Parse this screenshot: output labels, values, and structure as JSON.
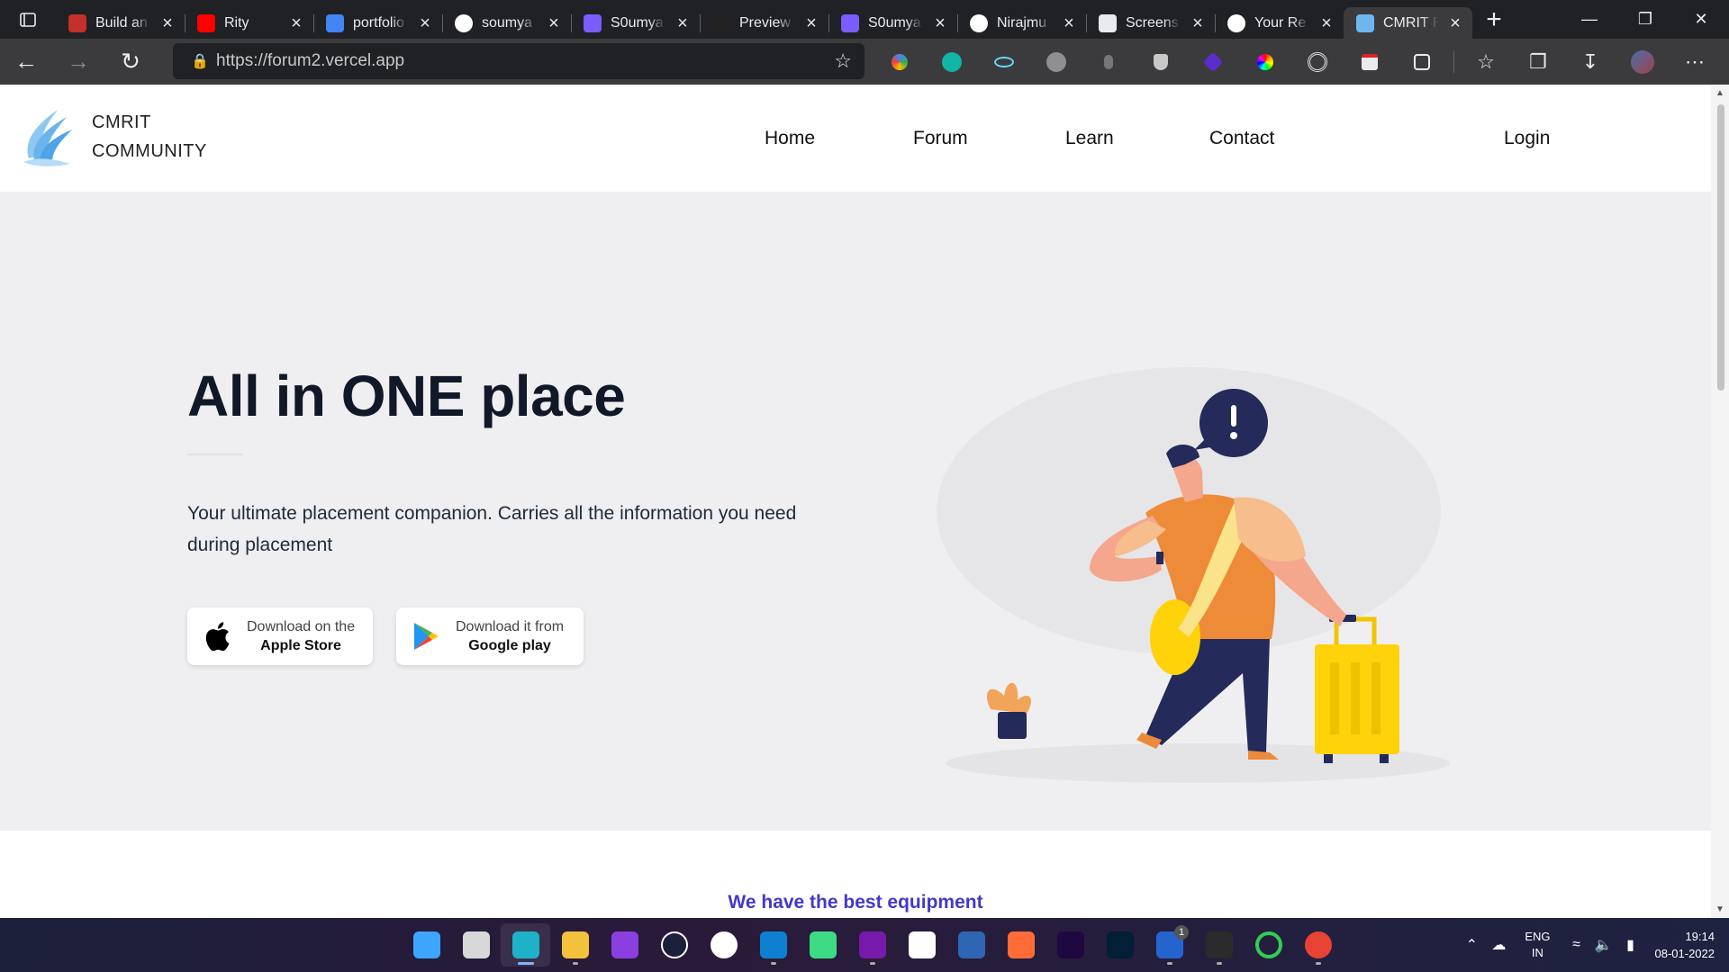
{
  "browser": {
    "tabs": [
      {
        "title": "Build an",
        "icon": "youtube-icon",
        "color": "#c4302b"
      },
      {
        "title": "Rity",
        "icon": "youtube-audio-icon",
        "color": "#ff0000"
      },
      {
        "title": "portfolio",
        "icon": "google-icon",
        "color": "#4285f4"
      },
      {
        "title": "soumya",
        "icon": "github-icon",
        "color": "#ffffff"
      },
      {
        "title": "S0umya",
        "icon": "app-icon",
        "color": "#7b5cff"
      },
      {
        "title": "Preview",
        "icon": "preview-icon",
        "color": "#222222"
      },
      {
        "title": "S0umya",
        "icon": "app-icon",
        "color": "#7b5cff"
      },
      {
        "title": "Nirajmu",
        "icon": "github-icon",
        "color": "#ffffff"
      },
      {
        "title": "Screens",
        "icon": "document-icon",
        "color": "#e8eaed"
      },
      {
        "title": "Your Re",
        "icon": "github-icon",
        "color": "#ffffff"
      },
      {
        "title": "CMRIT F",
        "icon": "cmrit-icon",
        "color": "#6fb6f0",
        "active": true
      }
    ],
    "url": "https://forum2.vercel.app"
  },
  "site": {
    "brand_line1": "CMRIT",
    "brand_line2": "COMMUNITY",
    "nav": [
      "Home",
      "Forum",
      "Learn",
      "Contact"
    ],
    "login": "Login"
  },
  "hero": {
    "title": "All in ONE place",
    "description": "Your ultimate placement companion. Carries all the information you need during placement",
    "apple_small": "Download on the",
    "apple_big": "Apple Store",
    "google_small": "Download it from",
    "google_big": "Google play"
  },
  "next_section": {
    "heading": "We have the best equipment"
  },
  "taskbar": {
    "apps": [
      "windows-start-icon",
      "task-view-icon",
      "edge-icon",
      "file-explorer-icon",
      "podcast-icon",
      "dell-icon",
      "photos-icon",
      "vscode-icon",
      "android-studio-icon",
      "onenote-icon",
      "mongodb-icon",
      "virtualbox-icon",
      "postman-icon",
      "after-effects-icon",
      "photoshop-icon",
      "todo-icon",
      "terminal-icon",
      "spinner-app-icon",
      "chrome-icon"
    ],
    "todo_badge": "1",
    "lang_line1": "ENG",
    "lang_line2": "IN",
    "time": "19:14",
    "date": "08-01-2022"
  }
}
